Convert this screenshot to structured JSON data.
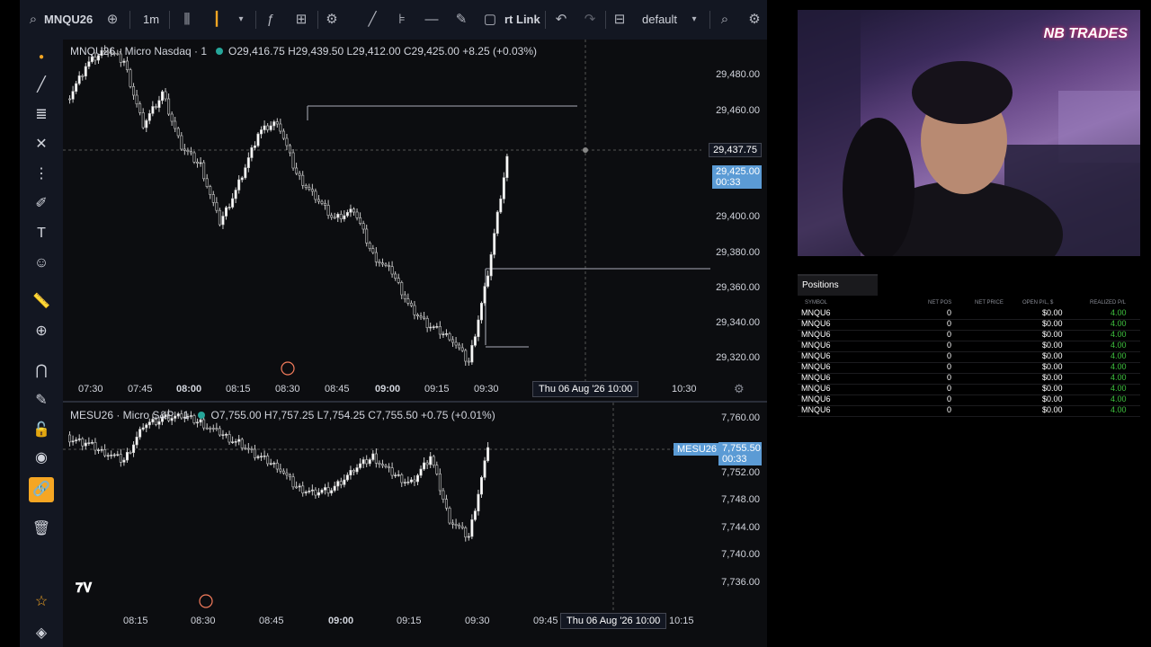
{
  "toolbar": {
    "symbol": "MNQU26",
    "interval": "1m",
    "link_label": "rt Link",
    "layout_name": "default"
  },
  "top_pane": {
    "legend_name": "MNQU26 · Micro Nasdaq · 1",
    "ohlc": "O29,416.75 H29,439.50 L29,412.00 C29,425.00 +8.25 (+0.03%)",
    "y_ticks": [
      "29,480.00",
      "29,460.00",
      "29,400.00",
      "29,380.00",
      "29,360.00",
      "29,340.00",
      "29,320.00"
    ],
    "crosshair_price": "29,437.75",
    "last_price": "29,425.00",
    "last_countdown": "00:33",
    "x_ticks": [
      "07:30",
      "07:45",
      "08:00",
      "08:15",
      "08:30",
      "08:45",
      "09:00",
      "09:15",
      "09:30",
      "10:30"
    ],
    "crosshair_time": "Thu 06 Aug '26   10:00"
  },
  "bottom_pane": {
    "legend_name": "MESU26 · Micro S&P · 1",
    "ohlc": "O7,755.00 H7,757.25 L7,754.25 C7,755.50 +0.75 (+0.01%)",
    "y_ticks": [
      "7,760.00",
      "7,752.00",
      "7,748.00",
      "7,744.00",
      "7,740.00",
      "7,736.00"
    ],
    "last_symbol": "MESU26",
    "last_price": "7,755.50",
    "last_countdown": "00:33",
    "x_ticks": [
      "08:15",
      "08:30",
      "08:45",
      "09:00",
      "09:15",
      "09:30",
      "09:45",
      "10:15"
    ],
    "crosshair_time": "Thu 06 Aug '26   10:00"
  },
  "webcam": {
    "logo_text": "NB TRADES"
  },
  "positions": {
    "title": "Positions",
    "columns": [
      "SYMBOL",
      "NET POS",
      "NET PRICE",
      "OPEN P/L, $",
      "REALIZED P/L"
    ],
    "rows": [
      {
        "symbol": "MNQU6",
        "net_pos": "0",
        "open_pl": "$0.00",
        "realized": "4.00"
      },
      {
        "symbol": "MNQU6",
        "net_pos": "0",
        "open_pl": "$0.00",
        "realized": "4.00"
      },
      {
        "symbol": "MNQU6",
        "net_pos": "0",
        "open_pl": "$0.00",
        "realized": "4.00"
      },
      {
        "symbol": "MNQU6",
        "net_pos": "0",
        "open_pl": "$0.00",
        "realized": "4.00"
      },
      {
        "symbol": "MNQU6",
        "net_pos": "0",
        "open_pl": "$0.00",
        "realized": "4.00"
      },
      {
        "symbol": "MNQU6",
        "net_pos": "0",
        "open_pl": "$0.00",
        "realized": "4.00"
      },
      {
        "symbol": "MNQU6",
        "net_pos": "0",
        "open_pl": "$0.00",
        "realized": "4.00"
      },
      {
        "symbol": "MNQU6",
        "net_pos": "0",
        "open_pl": "$0.00",
        "realized": "4.00"
      },
      {
        "symbol": "MNQU6",
        "net_pos": "0",
        "open_pl": "$0.00",
        "realized": "4.00"
      },
      {
        "symbol": "MNQU6",
        "net_pos": "0",
        "open_pl": "$0.00",
        "realized": "4.00"
      }
    ]
  }
}
